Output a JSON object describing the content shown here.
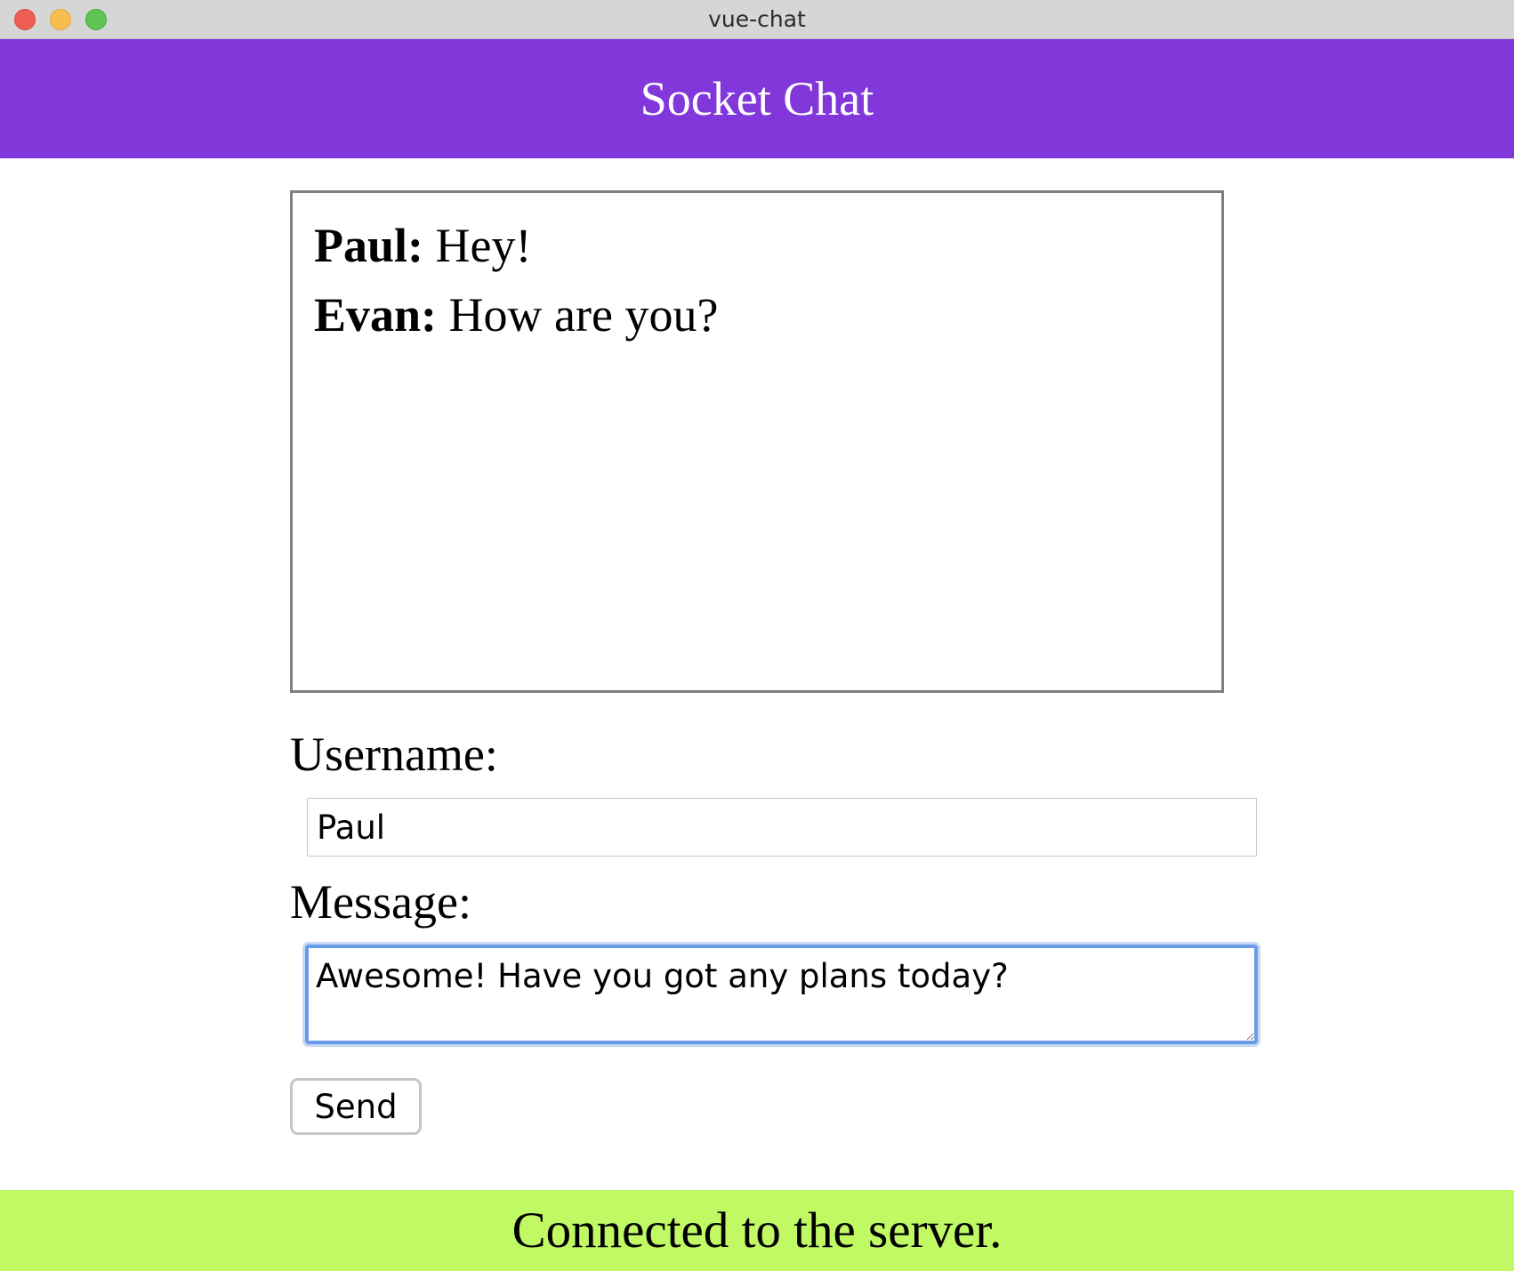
{
  "window": {
    "title": "vue-chat"
  },
  "header": {
    "title": "Socket Chat",
    "background_color": "#8137da"
  },
  "messages": [
    {
      "author": "Paul:",
      "text": " Hey!"
    },
    {
      "author": "Evan:",
      "text": " How are you?"
    }
  ],
  "form": {
    "username_label": "Username:",
    "username_value": "Paul",
    "message_label": "Message:",
    "message_value": "Awesome! Have you got any plans today?",
    "send_label": "Send"
  },
  "status": {
    "text": "Connected to the server.",
    "background_color": "#c1f964"
  }
}
